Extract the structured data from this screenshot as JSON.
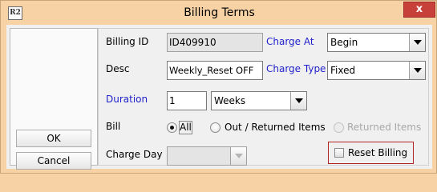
{
  "window": {
    "title": "Billing Terms",
    "app_logo_text": "R2",
    "close_glyph": "x",
    "accent_color": "#f7d2a5",
    "close_color": "#c7403a"
  },
  "buttons": {
    "ok_label": "OK",
    "cancel_label": "Cancel"
  },
  "form": {
    "billing_id": {
      "label": "Billing ID",
      "value": "ID409910"
    },
    "desc": {
      "label": "Desc",
      "value": "Weekly_Reset OFF"
    },
    "duration": {
      "label": "Duration",
      "value": "1",
      "unit": "Weeks"
    },
    "charge_at": {
      "label": "Charge At",
      "value": "Begin"
    },
    "charge_type": {
      "label": "Charge Type",
      "value": "Fixed"
    },
    "bill": {
      "label": "Bill",
      "options": [
        {
          "label": "All",
          "selected": true,
          "enabled": true
        },
        {
          "label": "Out / Returned Items",
          "selected": false,
          "enabled": true
        },
        {
          "label": "Returned Items",
          "selected": false,
          "enabled": false
        }
      ]
    },
    "charge_day": {
      "label": "Charge Day",
      "value": "",
      "enabled": false
    },
    "reset_billing": {
      "label": "Reset Billing",
      "checked": false
    }
  }
}
